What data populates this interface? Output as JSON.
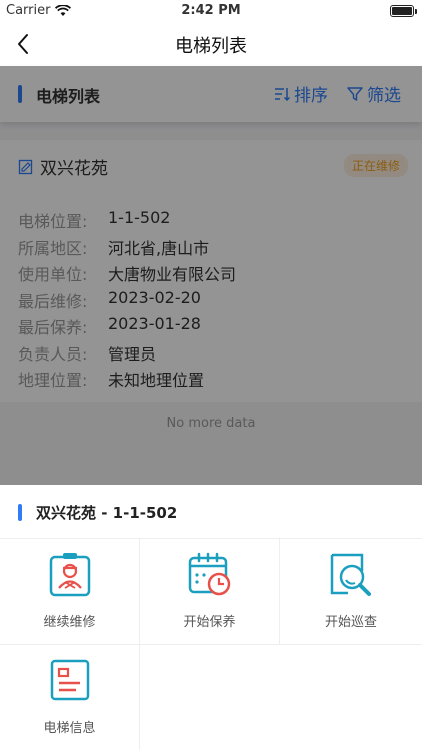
{
  "status_bar": {
    "carrier": "Carrier",
    "time": "2:42 PM"
  },
  "nav": {
    "title": "电梯列表"
  },
  "list_header": {
    "title": "电梯列表",
    "sort_label": "排序",
    "filter_label": "筛选"
  },
  "card": {
    "name": "双兴花苑",
    "status": "正在维修",
    "fields": [
      {
        "label": "电梯位置:",
        "value": "1-1-502"
      },
      {
        "label": "所属地区:",
        "value": "河北省,唐山市"
      },
      {
        "label": "使用单位:",
        "value": "大唐物业有限公司"
      },
      {
        "label": "最后维修:",
        "value": "2023-02-20"
      },
      {
        "label": "最后保养:",
        "value": "2023-01-28"
      },
      {
        "label": "负责人员:",
        "value": "管理员"
      },
      {
        "label": "地理位置:",
        "value": "未知地理位置"
      }
    ]
  },
  "footer": {
    "no_more": "No more data"
  },
  "sheet": {
    "title": "双兴花苑 - 1-1-502",
    "actions": [
      {
        "label": "继续维修",
        "icon": "repair-worker-icon"
      },
      {
        "label": "开始保养",
        "icon": "calendar-clock-icon"
      },
      {
        "label": "开始巡查",
        "icon": "inspect-search-icon"
      },
      {
        "label": "电梯信息",
        "icon": "document-info-icon"
      }
    ]
  },
  "colors": {
    "accent": "#2f7cf6",
    "status_orange": "#f0a020",
    "icon_teal": "#1b9fbf",
    "icon_red": "#e8504a"
  }
}
